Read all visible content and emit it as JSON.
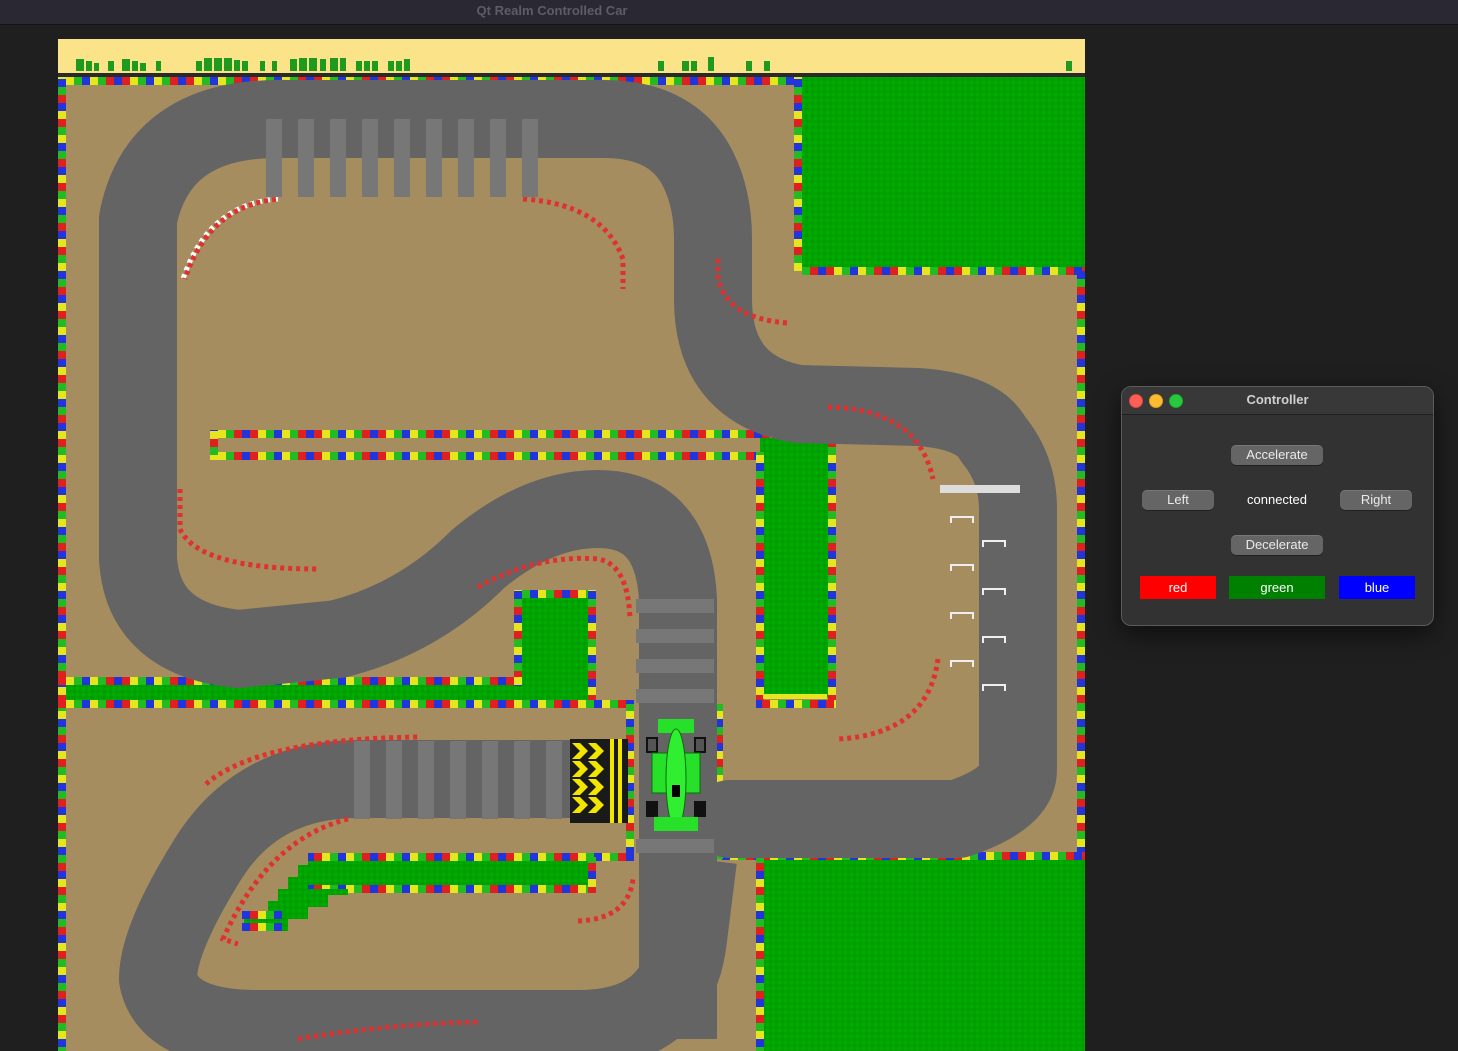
{
  "window": {
    "title": "Qt Realm Controlled Car"
  },
  "game": {
    "car_color": "#27e029",
    "track_color": "#646464",
    "ground_color": "#a58d5f",
    "grass_color": "#00a800",
    "sky_color": "#fce38b"
  },
  "controller": {
    "title": "Controller",
    "accelerate_label": "Accelerate",
    "left_label": "Left",
    "status": "connected",
    "right_label": "Right",
    "decelerate_label": "Decelerate",
    "colors": [
      {
        "label": "red",
        "value": "#ff0000"
      },
      {
        "label": "green",
        "value": "#008000"
      },
      {
        "label": "blue",
        "value": "#0000ff"
      }
    ]
  }
}
